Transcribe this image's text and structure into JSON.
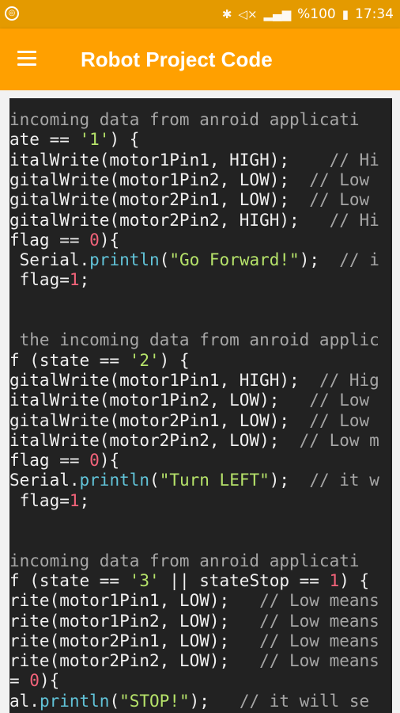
{
  "status_bar": {
    "battery": "%100",
    "time": "17:34",
    "icons": [
      "bluetooth-icon",
      "mute-icon",
      "signal-icon",
      "battery-icon"
    ]
  },
  "app_bar": {
    "title": "Robot Project Code",
    "menu_icon": "hamburger-menu-icon"
  },
  "colors": {
    "app_bar": "#ffa000",
    "status_bar": "#e49a00",
    "code_background": "#222222",
    "comment": "#a6a6a6",
    "string": "#b6e36a",
    "number": "#f4637a",
    "function": "#61c3d8"
  },
  "code": {
    "lines": [
      [
        {
          "t": "incoming data from anroid applicati",
          "k": "c"
        }
      ],
      [
        {
          "t": "ate == ",
          "k": ""
        },
        {
          "t": "'1'",
          "k": "s"
        },
        {
          "t": ") {",
          "k": ""
        }
      ],
      [
        {
          "t": "italWrite(motor1Pin1, HIGH);    ",
          "k": ""
        },
        {
          "t": "// Hi",
          "k": "c"
        }
      ],
      [
        {
          "t": "gitalWrite(motor1Pin2, LOW);  ",
          "k": ""
        },
        {
          "t": "// Low",
          "k": "c"
        }
      ],
      [
        {
          "t": "gitalWrite(motor2Pin1, LOW);  ",
          "k": ""
        },
        {
          "t": "// Low",
          "k": "c"
        }
      ],
      [
        {
          "t": "gitalWrite(motor2Pin2, HIGH);   ",
          "k": ""
        },
        {
          "t": "// Hi",
          "k": "c"
        }
      ],
      [
        {
          "t": "flag == ",
          "k": ""
        },
        {
          "t": "0",
          "k": "n"
        },
        {
          "t": "){",
          "k": ""
        }
      ],
      [
        {
          "t": " Serial.",
          "k": ""
        },
        {
          "t": "println",
          "k": "f"
        },
        {
          "t": "(",
          "k": ""
        },
        {
          "t": "\"Go Forward!\"",
          "k": "s"
        },
        {
          "t": ");  ",
          "k": ""
        },
        {
          "t": "// i",
          "k": "c"
        }
      ],
      [
        {
          "t": " flag=",
          "k": ""
        },
        {
          "t": "1",
          "k": "n"
        },
        {
          "t": ";",
          "k": ""
        }
      ],
      [
        {
          "t": "",
          "k": ""
        }
      ],
      [
        {
          "t": "",
          "k": ""
        }
      ],
      [
        {
          "t": " the incoming data from anroid applic",
          "k": "c"
        }
      ],
      [
        {
          "t": "f (state == ",
          "k": ""
        },
        {
          "t": "'2'",
          "k": "s"
        },
        {
          "t": ") {",
          "k": ""
        }
      ],
      [
        {
          "t": "gitalWrite(motor1Pin1, HIGH);  ",
          "k": ""
        },
        {
          "t": "// Hig",
          "k": "c"
        }
      ],
      [
        {
          "t": "italWrite(motor1Pin2, LOW);   ",
          "k": ""
        },
        {
          "t": "// Low",
          "k": "c"
        }
      ],
      [
        {
          "t": "gitalWrite(motor2Pin1, LOW);  ",
          "k": ""
        },
        {
          "t": "// Low",
          "k": "c"
        }
      ],
      [
        {
          "t": "italWrite(motor2Pin2, LOW);  ",
          "k": ""
        },
        {
          "t": "// Low m",
          "k": "c"
        }
      ],
      [
        {
          "t": "flag == ",
          "k": ""
        },
        {
          "t": "0",
          "k": "n"
        },
        {
          "t": "){",
          "k": ""
        }
      ],
      [
        {
          "t": "Serial.",
          "k": ""
        },
        {
          "t": "println",
          "k": "f"
        },
        {
          "t": "(",
          "k": ""
        },
        {
          "t": "\"Turn LEFT\"",
          "k": "s"
        },
        {
          "t": ");  ",
          "k": ""
        },
        {
          "t": "// it w",
          "k": "c"
        }
      ],
      [
        {
          "t": " flag=",
          "k": ""
        },
        {
          "t": "1",
          "k": "n"
        },
        {
          "t": ";",
          "k": ""
        }
      ],
      [
        {
          "t": "",
          "k": ""
        }
      ],
      [
        {
          "t": "",
          "k": ""
        }
      ],
      [
        {
          "t": "incoming data from anroid applicati",
          "k": "c"
        }
      ],
      [
        {
          "t": "f (state == ",
          "k": ""
        },
        {
          "t": "'3'",
          "k": "s"
        },
        {
          "t": " || stateStop == ",
          "k": ""
        },
        {
          "t": "1",
          "k": "n"
        },
        {
          "t": ") {",
          "k": ""
        }
      ],
      [
        {
          "t": "rite(motor1Pin1, LOW);   ",
          "k": ""
        },
        {
          "t": "// Low means",
          "k": "c"
        }
      ],
      [
        {
          "t": "rite(motor1Pin2, LOW);   ",
          "k": ""
        },
        {
          "t": "// Low means",
          "k": "c"
        }
      ],
      [
        {
          "t": "rite(motor2Pin1, LOW);   ",
          "k": ""
        },
        {
          "t": "// Low means",
          "k": "c"
        }
      ],
      [
        {
          "t": "rite(motor2Pin2, LOW);   ",
          "k": ""
        },
        {
          "t": "// Low means",
          "k": "c"
        }
      ],
      [
        {
          "t": "= ",
          "k": ""
        },
        {
          "t": "0",
          "k": "n"
        },
        {
          "t": "){",
          "k": ""
        }
      ],
      [
        {
          "t": "al.",
          "k": ""
        },
        {
          "t": "println",
          "k": "f"
        },
        {
          "t": "(",
          "k": ""
        },
        {
          "t": "\"STOP!\"",
          "k": "s"
        },
        {
          "t": ");   ",
          "k": ""
        },
        {
          "t": "// it will se",
          "k": "c"
        }
      ]
    ]
  }
}
